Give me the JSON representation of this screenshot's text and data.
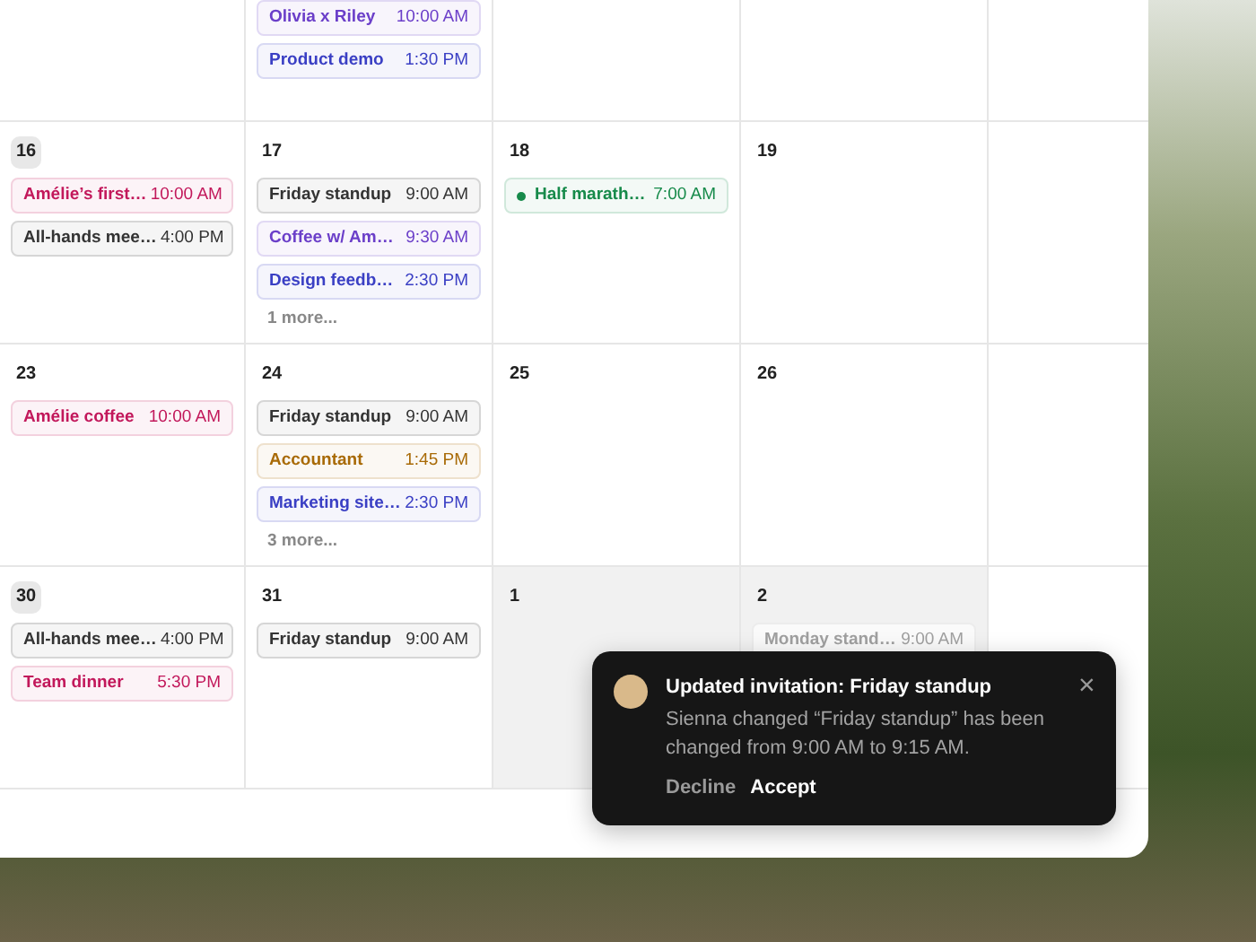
{
  "calendar": {
    "weeks": [
      {
        "days": [
          {
            "outside_month": false
          },
          {
            "outside_month": false,
            "events": [
              {
                "title": "Olivia x Riley",
                "time": "10:00 AM",
                "color": "#6b3fc9"
              },
              {
                "title": "Product demo",
                "time": "1:30 PM",
                "color": "#3a3fc4"
              }
            ]
          },
          {
            "outside_month": false
          },
          {
            "outside_month": false
          }
        ]
      },
      {
        "days": [
          {
            "date": "16",
            "highlighted": true,
            "outside_month": false,
            "events": [
              {
                "title": "Amélie’s first…",
                "time": "10:00 AM",
                "color": "#c2185b"
              },
              {
                "title": "All-hands mee…",
                "time": "4:00 PM",
                "color": "#333333"
              }
            ]
          },
          {
            "date": "17",
            "highlighted": false,
            "outside_month": false,
            "events": [
              {
                "title": "Friday standup",
                "time": "9:00 AM",
                "color": "#333333"
              },
              {
                "title": "Coffee w/ Am…",
                "time": "9:30 AM",
                "color": "#6b3fc9"
              },
              {
                "title": "Design feedb…",
                "time": "2:30 PM",
                "color": "#3a3fc4"
              }
            ],
            "more": "1 more..."
          },
          {
            "date": "18",
            "highlighted": false,
            "outside_month": false,
            "events": [
              {
                "title": "Half marath…",
                "time": "7:00 AM",
                "color": "#168a4a",
                "dot": true
              }
            ]
          },
          {
            "date": "19",
            "highlighted": false,
            "outside_month": false
          }
        ]
      },
      {
        "days": [
          {
            "date": "23",
            "highlighted": false,
            "outside_month": false,
            "events": [
              {
                "title": "Amélie coffee",
                "time": "10:00 AM",
                "color": "#c2185b"
              }
            ]
          },
          {
            "date": "24",
            "highlighted": false,
            "outside_month": false,
            "events": [
              {
                "title": "Friday standup",
                "time": "9:00 AM",
                "color": "#333333"
              },
              {
                "title": "Accountant",
                "time": "1:45 PM",
                "color": "#a86a06"
              },
              {
                "title": "Marketing site…",
                "time": "2:30 PM",
                "color": "#3a3fc4"
              }
            ],
            "more": "3 more..."
          },
          {
            "date": "25",
            "highlighted": false,
            "outside_month": false
          },
          {
            "date": "26",
            "highlighted": false,
            "outside_month": false
          }
        ]
      },
      {
        "days": [
          {
            "date": "30",
            "highlighted": true,
            "outside_month": false,
            "events": [
              {
                "title": "All-hands mee…",
                "time": "4:00 PM",
                "color": "#333333"
              },
              {
                "title": "Team dinner",
                "time": "5:30 PM",
                "color": "#c2185b"
              }
            ]
          },
          {
            "date": "31",
            "highlighted": false,
            "outside_month": false,
            "events": [
              {
                "title": "Friday standup",
                "time": "9:00 AM",
                "color": "#333333"
              }
            ]
          },
          {
            "date": "1",
            "highlighted": false,
            "outside_month": true
          },
          {
            "date": "2",
            "highlighted": false,
            "outside_month": true,
            "events": [
              {
                "title": "Monday stand…",
                "time": "9:00 AM",
                "color": "#a0a0a0"
              }
            ]
          }
        ]
      }
    ]
  },
  "notification": {
    "title": "Updated invitation: Friday standup",
    "message": "Sienna changed “Friday standup” has been changed from 9:00 AM to 9:15 AM.",
    "close": "×",
    "actions": [
      "Decline",
      "Accept"
    ]
  }
}
